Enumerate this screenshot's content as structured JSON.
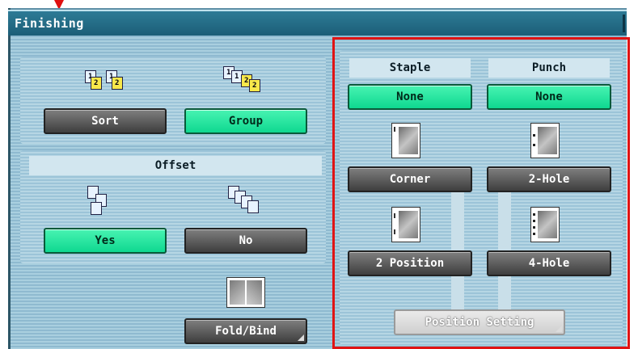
{
  "window": {
    "title": "Finishing"
  },
  "sort_group": {
    "sort_label": "Sort",
    "group_label": "Group",
    "sort_icon_labels": [
      "1",
      "2",
      "1",
      "2"
    ],
    "group_icon_labels": [
      "1",
      "1",
      "2",
      "2"
    ],
    "selected": "Group"
  },
  "offset": {
    "header": "Offset",
    "yes_label": "Yes",
    "no_label": "No",
    "selected": "Yes"
  },
  "fold_bind": {
    "label": "Fold/Bind"
  },
  "staple": {
    "header": "Staple",
    "none_label": "None",
    "corner_label": "Corner",
    "two_position_label": "2 Position",
    "selected": "None"
  },
  "punch": {
    "header": "Punch",
    "none_label": "None",
    "two_hole_label": "2-Hole",
    "four_hole_label": "4-Hole",
    "selected": "None"
  },
  "position_setting": {
    "label": "Position Setting",
    "enabled": false
  },
  "colors": {
    "selected_green": "#1ee09c",
    "unselected_gray": "#555555",
    "highlight_red": "#e01414",
    "title_bar": "#1c5e77"
  }
}
